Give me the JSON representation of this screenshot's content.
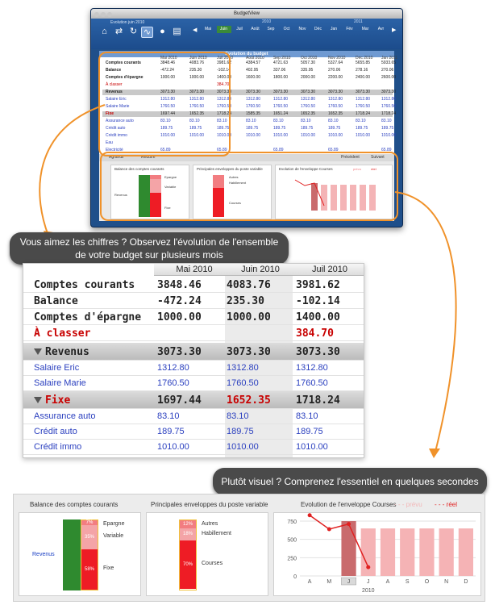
{
  "window": {
    "title": "BudgetView",
    "subtitle": "Evolution juin 2010",
    "panel_title": "Evolution du budget",
    "years": [
      "2010",
      "2011"
    ],
    "months": [
      "Mai",
      "Juin",
      "Juil",
      "Août",
      "Sep",
      "Oct",
      "Nov",
      "Déc",
      "Jan",
      "Fév",
      "Mar",
      "Avr"
    ],
    "current_month_index": 1,
    "columns": [
      "Mai 2010",
      "Juin 2010",
      "Juil 2010",
      "Août 2010",
      "Sep 2010",
      "Oct 2010",
      "Nov 2010",
      "Déc 2010",
      "Jan 2011"
    ],
    "rows": [
      {
        "label": "Comptes courants",
        "values": [
          "3848.46",
          "4083.76",
          "3981.62",
          "4384.57",
          "4721.63",
          "5057.30",
          "5327.64",
          "5655.85",
          "5933.65"
        ],
        "bold": true
      },
      {
        "label": "Balance",
        "values": [
          "-472.24",
          "235.30",
          "-102.14",
          "402.95",
          "337.06",
          "335.95",
          "270.06",
          "278.16",
          "270.06"
        ],
        "bold": true
      },
      {
        "label": "Comptes d'épargne",
        "values": [
          "1000.00",
          "1000.00",
          "1400.00",
          "1600.00",
          "1800.00",
          "2000.00",
          "2200.00",
          "2400.00",
          "2600.00"
        ],
        "bold": true
      },
      {
        "label": "À classer",
        "values": [
          "",
          "",
          "384.70",
          "",
          "",
          "",
          "",
          "",
          ""
        ],
        "red": true
      },
      {
        "label": "Revenus",
        "values": [
          "3073.30",
          "3073.30",
          "3073.30",
          "3073.30",
          "3073.30",
          "3073.30",
          "3073.30",
          "3073.30",
          "3073.30"
        ],
        "group": true
      },
      {
        "label": "Salaire Eric",
        "values": [
          "1312.80",
          "1312.80",
          "1312.80",
          "1312.80",
          "1312.80",
          "1312.80",
          "1312.80",
          "1312.80",
          "1312.80"
        ],
        "blue": true
      },
      {
        "label": "Salaire Marie",
        "values": [
          "1760.50",
          "1760.50",
          "1760.50",
          "1760.50",
          "1760.50",
          "1760.50",
          "1760.50",
          "1760.50",
          "1760.50"
        ],
        "blue": true
      },
      {
        "label": "Fixe",
        "values": [
          "1697.44",
          "1652.35",
          "1718.24",
          "1585.35",
          "1651.24",
          "1652.35",
          "1652.35",
          "1718.24",
          "1718.24"
        ],
        "group": true,
        "red": true
      },
      {
        "label": "Assurance auto",
        "values": [
          "83.10",
          "83.10",
          "83.10",
          "83.10",
          "83.10",
          "83.10",
          "83.10",
          "83.10",
          "83.10"
        ],
        "blue": true
      },
      {
        "label": "Crédit auto",
        "values": [
          "189.75",
          "189.75",
          "189.75",
          "189.75",
          "189.75",
          "189.75",
          "189.75",
          "189.75",
          "189.75"
        ],
        "blue": true
      },
      {
        "label": "Crédit immo",
        "values": [
          "1010.00",
          "1010.00",
          "1010.00",
          "1010.00",
          "1010.00",
          "1010.00",
          "1010.00",
          "1010.00",
          "1010.00"
        ],
        "blue": true
      },
      {
        "label": "Eau",
        "values": [
          "",
          "",
          "",
          "",
          "",
          "",
          "",
          "",
          ""
        ],
        "blue": true
      },
      {
        "label": "Electricité",
        "values": [
          "65.89",
          "",
          "65.89",
          "",
          "65.89",
          "",
          "65.89",
          "",
          "65.89"
        ],
        "blue": true
      }
    ],
    "footer": {
      "expand": "Agrandir",
      "collapse": "Réduire",
      "previous": "Précédent",
      "next": "Suivant"
    },
    "mini_charts": {
      "balance_title": "Balance des comptes courants",
      "envelopes_title": "Principales enveloppes du poste variable",
      "evolution_title": "Evolution de l'enveloppe Courses",
      "legend_planned": "prévu",
      "legend_actual": "réel",
      "revenus": "Revenus",
      "epargne": "Epargne",
      "variable": "Variable",
      "fixe": "Fixe",
      "autres": "Autres",
      "habillement": "Habillement",
      "courses": "Courses"
    }
  },
  "callouts": {
    "figures": "Vous aimez les chiffres ? Observez l'évolution de l'ensemble de votre budget sur plusieurs mois",
    "visual": "Plutôt visuel ? Comprenez l'essentiel en quelques secondes"
  },
  "table": {
    "months": [
      "Mai 2010",
      "Juin 2010",
      "Juil 2010"
    ],
    "summary": [
      {
        "label": "Comptes courants",
        "values": [
          "3848.46",
          "4083.76",
          "3981.62"
        ]
      },
      {
        "label": "Balance",
        "values": [
          "-472.24",
          "235.30",
          "-102.14"
        ]
      },
      {
        "label": "Comptes d'épargne",
        "values": [
          "1000.00",
          "1000.00",
          "1400.00"
        ]
      },
      {
        "label": "À classer",
        "values": [
          "",
          "",
          "384.70"
        ]
      }
    ],
    "revenus": {
      "label": "Revenus",
      "values": [
        "3073.30",
        "3073.30",
        "3073.30"
      ]
    },
    "revenus_items": [
      {
        "label": "Salaire Eric",
        "values": [
          "1312.80",
          "1312.80",
          "1312.80"
        ]
      },
      {
        "label": "Salaire Marie",
        "values": [
          "1760.50",
          "1760.50",
          "1760.50"
        ]
      }
    ],
    "fixe": {
      "label": "Fixe",
      "values": [
        "1697.44",
        "1652.35",
        "1718.24"
      ]
    },
    "fixe_items": [
      {
        "label": "Assurance auto",
        "values": [
          "83.10",
          "83.10",
          "83.10"
        ]
      },
      {
        "label": "Crédit auto",
        "values": [
          "189.75",
          "189.75",
          "189.75"
        ]
      },
      {
        "label": "Crédit immo",
        "values": [
          "1010.00",
          "1010.00",
          "1010.00"
        ]
      }
    ]
  },
  "charts": {
    "balance": {
      "title": "Balance des comptes courants",
      "left_label": "Revenus",
      "segments": [
        {
          "label": "Epargne",
          "percent": "7%",
          "fraction": 0.07
        },
        {
          "label": "Variable",
          "percent": "35%",
          "fraction": 0.35
        },
        {
          "label": "Fixe",
          "percent": "58%",
          "fraction": 0.58
        }
      ]
    },
    "envelopes": {
      "title": "Principales enveloppes du poste variable",
      "segments": [
        {
          "label": "Autres",
          "percent": "12%",
          "fraction": 0.12
        },
        {
          "label": "Habillement",
          "percent": "18%",
          "fraction": 0.18
        },
        {
          "label": "Courses",
          "percent": "70%",
          "fraction": 0.7
        }
      ]
    },
    "colors": {
      "green": "#2f8a2f",
      "red": "#ee1c25",
      "pink": "#f27d81",
      "light_pink": "#f4a4a7",
      "orange_border": "#f0922a",
      "callout_bg": "#4a4a4a",
      "planned_line": "#f2b8b9",
      "actual_line": "#e02020"
    }
  },
  "chart_data": {
    "type": "bar",
    "title": "Evolution de l'enveloppe Courses",
    "categories": [
      "A",
      "M",
      "J",
      "J",
      "A",
      "S",
      "O",
      "N",
      "D"
    ],
    "x_caption": "2010",
    "ylim": [
      0,
      750
    ],
    "yticks": [
      0,
      250,
      500,
      750
    ],
    "highlight_index": 2,
    "series": [
      {
        "name": "prévu",
        "type": "bar",
        "values": [
          null,
          null,
          750,
          650,
          650,
          650,
          650,
          650,
          650
        ]
      },
      {
        "name": "réel",
        "type": "line",
        "values": [
          830,
          640,
          710,
          120,
          null,
          null,
          null,
          null,
          null
        ]
      }
    ],
    "legend": "top-right",
    "grid": true
  }
}
